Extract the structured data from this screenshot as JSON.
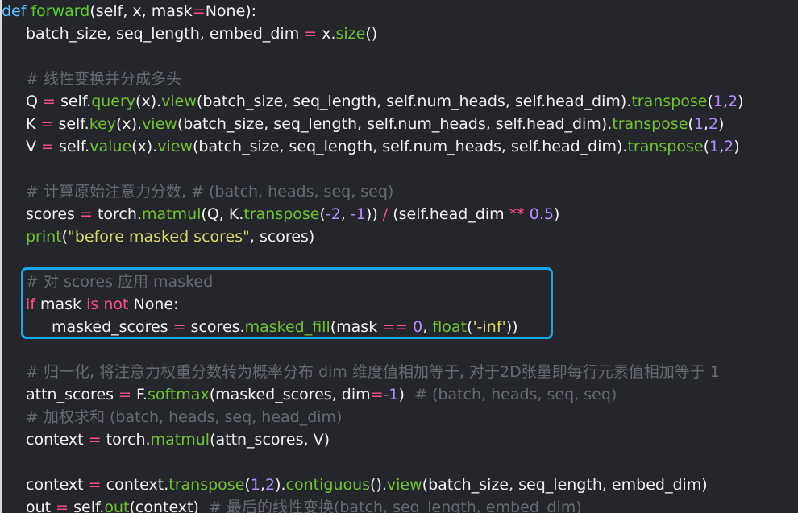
{
  "editor": {
    "lines": [
      [
        {
          "t": "def",
          "c": "def"
        },
        {
          "t": " forward",
          "c": "fn"
        },
        {
          "t": "(self, x, mask",
          "c": "plain"
        },
        {
          "t": "=",
          "c": "op"
        },
        {
          "t": "None):",
          "c": "plain"
        }
      ],
      [
        {
          "t": "batch_size, seq_length, embed_dim ",
          "c": "plain"
        },
        {
          "t": "=",
          "c": "op"
        },
        {
          "t": " x.",
          "c": "plain"
        },
        {
          "t": "size",
          "c": "call"
        },
        {
          "t": "()",
          "c": "plain"
        }
      ],
      [],
      [
        {
          "t": "# 线性变换并分成多头",
          "c": "com"
        }
      ],
      [
        {
          "t": "Q ",
          "c": "plain"
        },
        {
          "t": "=",
          "c": "op"
        },
        {
          "t": " self.",
          "c": "plain"
        },
        {
          "t": "query",
          "c": "call"
        },
        {
          "t": "(x).",
          "c": "plain"
        },
        {
          "t": "view",
          "c": "call"
        },
        {
          "t": "(batch_size, seq_length, self.num_heads, self.head_dim).",
          "c": "plain"
        },
        {
          "t": "transpose",
          "c": "call"
        },
        {
          "t": "(",
          "c": "plain"
        },
        {
          "t": "1",
          "c": "num"
        },
        {
          "t": ",",
          "c": "plain"
        },
        {
          "t": "2",
          "c": "num"
        },
        {
          "t": ")",
          "c": "plain"
        }
      ],
      [
        {
          "t": "K ",
          "c": "plain"
        },
        {
          "t": "=",
          "c": "op"
        },
        {
          "t": " self.",
          "c": "plain"
        },
        {
          "t": "key",
          "c": "call"
        },
        {
          "t": "(x).",
          "c": "plain"
        },
        {
          "t": "view",
          "c": "call"
        },
        {
          "t": "(batch_size, seq_length, self.num_heads, self.head_dim).",
          "c": "plain"
        },
        {
          "t": "transpose",
          "c": "call"
        },
        {
          "t": "(",
          "c": "plain"
        },
        {
          "t": "1",
          "c": "num"
        },
        {
          "t": ",",
          "c": "plain"
        },
        {
          "t": "2",
          "c": "num"
        },
        {
          "t": ")",
          "c": "plain"
        }
      ],
      [
        {
          "t": "V ",
          "c": "plain"
        },
        {
          "t": "=",
          "c": "op"
        },
        {
          "t": " self.",
          "c": "plain"
        },
        {
          "t": "value",
          "c": "call"
        },
        {
          "t": "(x).",
          "c": "plain"
        },
        {
          "t": "view",
          "c": "call"
        },
        {
          "t": "(batch_size, seq_length, self.num_heads, self.head_dim).",
          "c": "plain"
        },
        {
          "t": "transpose",
          "c": "call"
        },
        {
          "t": "(",
          "c": "plain"
        },
        {
          "t": "1",
          "c": "num"
        },
        {
          "t": ",",
          "c": "plain"
        },
        {
          "t": "2",
          "c": "num"
        },
        {
          "t": ")",
          "c": "plain"
        }
      ],
      [],
      [
        {
          "t": "# 计算原始注意力分数, # (batch, heads, seq, seq)",
          "c": "com"
        }
      ],
      [
        {
          "t": "scores ",
          "c": "plain"
        },
        {
          "t": "=",
          "c": "op"
        },
        {
          "t": " torch.",
          "c": "plain"
        },
        {
          "t": "matmul",
          "c": "call"
        },
        {
          "t": "(Q, K.",
          "c": "plain"
        },
        {
          "t": "transpose",
          "c": "call"
        },
        {
          "t": "(",
          "c": "plain"
        },
        {
          "t": "-2",
          "c": "num"
        },
        {
          "t": ", ",
          "c": "plain"
        },
        {
          "t": "-1",
          "c": "num"
        },
        {
          "t": ")) ",
          "c": "plain"
        },
        {
          "t": "/",
          "c": "op"
        },
        {
          "t": " (self.head_dim ",
          "c": "plain"
        },
        {
          "t": "**",
          "c": "op"
        },
        {
          "t": " ",
          "c": "plain"
        },
        {
          "t": "0.5",
          "c": "num"
        },
        {
          "t": ")",
          "c": "plain"
        }
      ],
      [
        {
          "t": "print",
          "c": "call"
        },
        {
          "t": "(",
          "c": "plain"
        },
        {
          "t": "\"before masked scores\"",
          "c": "str"
        },
        {
          "t": ", scores)",
          "c": "plain"
        }
      ],
      [],
      [
        {
          "t": "# 对 scores 应用 masked",
          "c": "com"
        }
      ],
      [
        {
          "t": "if",
          "c": "kw"
        },
        {
          "t": " mask ",
          "c": "plain"
        },
        {
          "t": "is",
          "c": "kw"
        },
        {
          "t": " ",
          "c": "plain"
        },
        {
          "t": "not",
          "c": "kw"
        },
        {
          "t": " None:",
          "c": "plain"
        }
      ],
      [
        {
          "t": "masked_scores ",
          "c": "plain"
        },
        {
          "t": "=",
          "c": "op"
        },
        {
          "t": " scores.",
          "c": "plain"
        },
        {
          "t": "masked_fill",
          "c": "call"
        },
        {
          "t": "(mask ",
          "c": "plain"
        },
        {
          "t": "==",
          "c": "op"
        },
        {
          "t": " ",
          "c": "plain"
        },
        {
          "t": "0",
          "c": "num"
        },
        {
          "t": ", ",
          "c": "plain"
        },
        {
          "t": "float",
          "c": "call"
        },
        {
          "t": "(",
          "c": "plain"
        },
        {
          "t": "'-inf'",
          "c": "str"
        },
        {
          "t": "))",
          "c": "plain"
        }
      ],
      [],
      [
        {
          "t": "# 归一化, 将注意力权重分数转为概率分布 dim 维度值相加等于, 对于2D张量即每行元素值相加等于 1",
          "c": "com"
        }
      ],
      [
        {
          "t": "attn_scores ",
          "c": "plain"
        },
        {
          "t": "=",
          "c": "op"
        },
        {
          "t": " F.",
          "c": "plain"
        },
        {
          "t": "softmax",
          "c": "call"
        },
        {
          "t": "(masked_scores, dim",
          "c": "plain"
        },
        {
          "t": "=",
          "c": "op"
        },
        {
          "t": "-1",
          "c": "num"
        },
        {
          "t": ")  ",
          "c": "plain"
        },
        {
          "t": "# (batch, heads, seq, seq)",
          "c": "com"
        }
      ],
      [
        {
          "t": "# 加权求和 (batch, heads, seq, head_dim)",
          "c": "com"
        }
      ],
      [
        {
          "t": "context ",
          "c": "plain"
        },
        {
          "t": "=",
          "c": "op"
        },
        {
          "t": " torch.",
          "c": "plain"
        },
        {
          "t": "matmul",
          "c": "call"
        },
        {
          "t": "(attn_scores, V)",
          "c": "plain"
        }
      ],
      [],
      [
        {
          "t": "context ",
          "c": "plain"
        },
        {
          "t": "=",
          "c": "op"
        },
        {
          "t": " context.",
          "c": "plain"
        },
        {
          "t": "transpose",
          "c": "call"
        },
        {
          "t": "(",
          "c": "plain"
        },
        {
          "t": "1",
          "c": "num"
        },
        {
          "t": ",",
          "c": "plain"
        },
        {
          "t": "2",
          "c": "num"
        },
        {
          "t": ").",
          "c": "plain"
        },
        {
          "t": "contiguous",
          "c": "call"
        },
        {
          "t": "().",
          "c": "plain"
        },
        {
          "t": "view",
          "c": "call"
        },
        {
          "t": "(batch_size, seq_length, embed_dim)",
          "c": "plain"
        }
      ],
      [
        {
          "t": "out ",
          "c": "plain"
        },
        {
          "t": "=",
          "c": "op"
        },
        {
          "t": " self.",
          "c": "plain"
        },
        {
          "t": "out",
          "c": "call"
        },
        {
          "t": "(context)  ",
          "c": "plain"
        },
        {
          "t": "# 最后的线性变换(batch, seq_length, embed_dim)",
          "c": "com"
        }
      ]
    ]
  },
  "colors": {
    "background": "#25262b",
    "highlight_border": "#14a9e8"
  }
}
